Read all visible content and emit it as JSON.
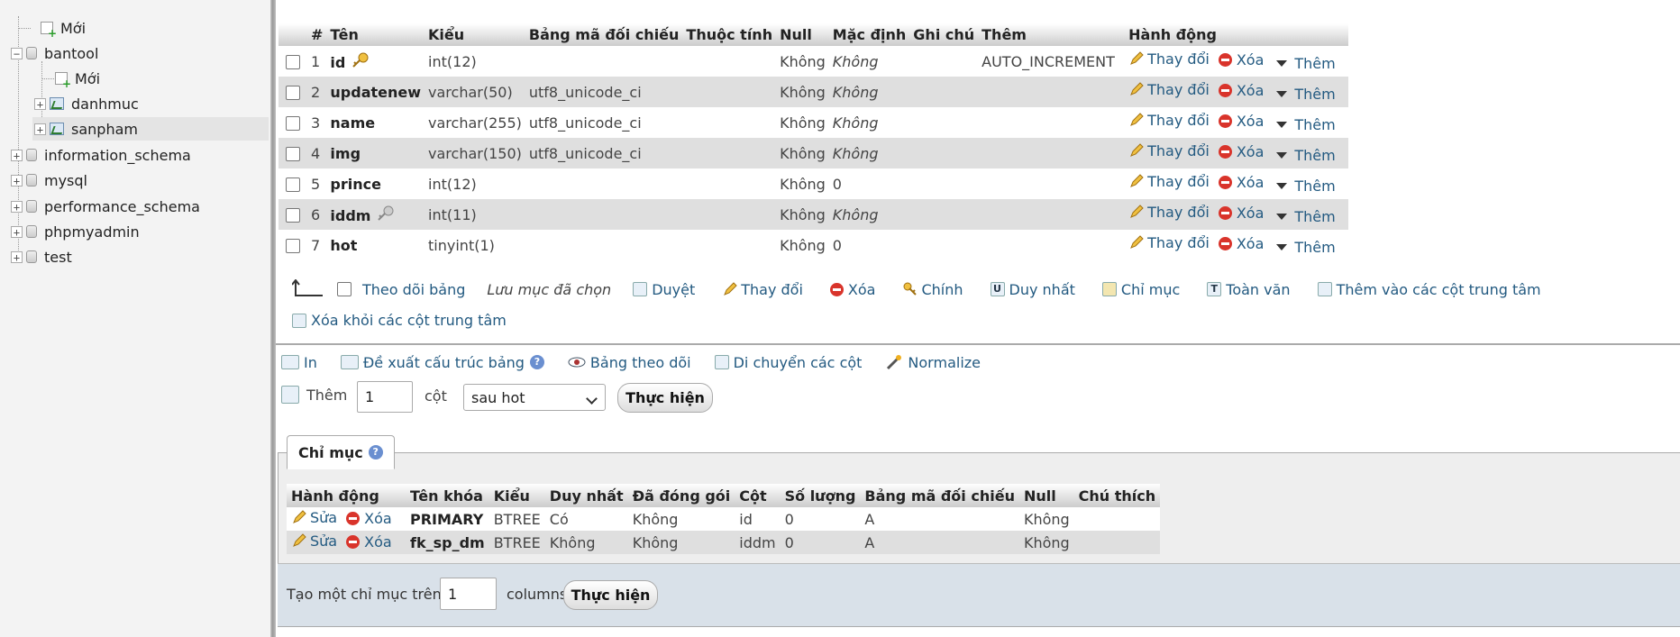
{
  "sidebar": {
    "items": [
      {
        "label": "Mới",
        "kind": "new"
      },
      {
        "label": "bantool",
        "kind": "db",
        "expander": "−"
      },
      {
        "label": "Mới",
        "kind": "new"
      },
      {
        "label": "danhmuc",
        "kind": "table",
        "expander": "+"
      },
      {
        "label": "sanpham",
        "kind": "table",
        "expander": "+",
        "selected": true
      },
      {
        "label": "information_schema",
        "kind": "db",
        "expander": "+"
      },
      {
        "label": "mysql",
        "kind": "db",
        "expander": "+"
      },
      {
        "label": "performance_schema",
        "kind": "db",
        "expander": "+"
      },
      {
        "label": "phpmyadmin",
        "kind": "db",
        "expander": "+"
      },
      {
        "label": "test",
        "kind": "db",
        "expander": "+"
      }
    ]
  },
  "structure": {
    "headers": [
      "#",
      "Tên",
      "Kiểu",
      "Bảng mã đối chiếu",
      "Thuộc tính",
      "Null",
      "Mặc định",
      "Ghi chú",
      "Thêm",
      "Hành động"
    ],
    "rows": [
      {
        "num": "1",
        "name": "id",
        "key": "primary",
        "type": "int(12)",
        "collation": "",
        "attr": "",
        "null": "Không",
        "default": "Không",
        "default_italic": true,
        "comment": "",
        "extra": "AUTO_INCREMENT"
      },
      {
        "num": "2",
        "name": "updatenew",
        "key": "",
        "type": "varchar(50)",
        "collation": "utf8_unicode_ci",
        "attr": "",
        "null": "Không",
        "default": "Không",
        "default_italic": true,
        "comment": "",
        "extra": ""
      },
      {
        "num": "3",
        "name": "name",
        "key": "",
        "type": "varchar(255)",
        "collation": "utf8_unicode_ci",
        "attr": "",
        "null": "Không",
        "default": "Không",
        "default_italic": true,
        "comment": "",
        "extra": ""
      },
      {
        "num": "4",
        "name": "img",
        "key": "",
        "type": "varchar(150)",
        "collation": "utf8_unicode_ci",
        "attr": "",
        "null": "Không",
        "default": "Không",
        "default_italic": true,
        "comment": "",
        "extra": ""
      },
      {
        "num": "5",
        "name": "prince",
        "key": "",
        "type": "int(12)",
        "collation": "",
        "attr": "",
        "null": "Không",
        "default": "0",
        "default_italic": false,
        "comment": "",
        "extra": ""
      },
      {
        "num": "6",
        "name": "iddm",
        "key": "index",
        "type": "int(11)",
        "collation": "",
        "attr": "",
        "null": "Không",
        "default": "Không",
        "default_italic": true,
        "comment": "",
        "extra": ""
      },
      {
        "num": "7",
        "name": "hot",
        "key": "",
        "type": "tinyint(1)",
        "collation": "",
        "attr": "",
        "null": "Không",
        "default": "0",
        "default_italic": false,
        "comment": "",
        "extra": ""
      }
    ],
    "row_actions": {
      "change": "Thay đổi",
      "drop": "Xóa",
      "more": "Thêm"
    }
  },
  "bulk": {
    "check_all": "Theo dõi bảng",
    "with_selected": "Lưu mục đã chọn",
    "actions": [
      "Duyệt",
      "Thay đổi",
      "Xóa",
      "Chính",
      "Duy nhất",
      "Chỉ mục",
      "Toàn văn",
      "Thêm vào các cột trung tâm"
    ],
    "remove_central": "Xóa khỏi các cột trung tâm"
  },
  "tools": {
    "print": "In",
    "propose": "Đề xuất cấu trúc bảng",
    "track": "Bảng theo dõi",
    "move_columns": "Di chuyển các cột",
    "normalize": "Normalize"
  },
  "add_column": {
    "label": "Thêm",
    "count": "1",
    "unit": "cột",
    "position": "sau hot",
    "go": "Thực hiện"
  },
  "indexes": {
    "tab": "Chỉ mục",
    "headers": [
      "Hành động",
      "Tên khóa",
      "Kiểu",
      "Duy nhất",
      "Đã đóng gói",
      "Cột",
      "Số lượng",
      "Bảng mã đối chiếu",
      "Null",
      "Chú thích"
    ],
    "edit": "Sửa",
    "drop": "Xóa",
    "rows": [
      {
        "key": "PRIMARY",
        "type": "BTREE",
        "unique": "Có",
        "packed": "Không",
        "column": "id",
        "cardinality": "0",
        "collation": "A",
        "null": "Không",
        "comment": ""
      },
      {
        "key": "fk_sp_dm",
        "type": "BTREE",
        "unique": "Không",
        "packed": "Không",
        "column": "iddm",
        "cardinality": "0",
        "collation": "A",
        "null": "Không",
        "comment": ""
      }
    ]
  },
  "create_index": {
    "label": "Tạo một chỉ mục trên",
    "count": "1",
    "unit": "columns",
    "go": "Thực hiện"
  }
}
